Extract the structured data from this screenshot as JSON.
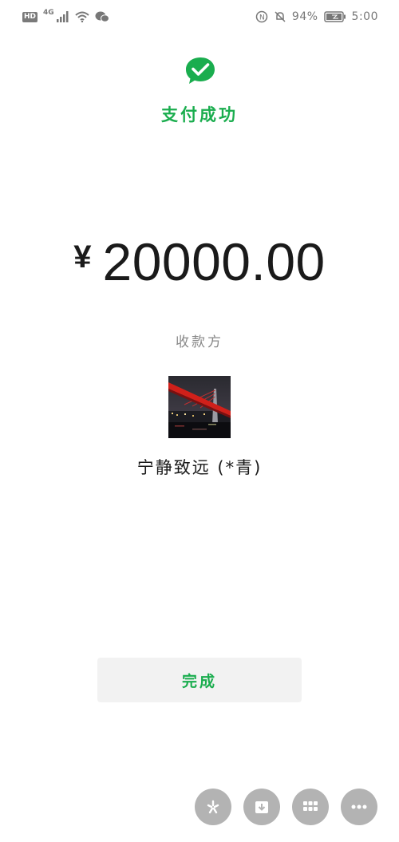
{
  "status_bar": {
    "hd_badge": "HD",
    "network_label": "4G",
    "battery_percent": "94%",
    "time": "5:00",
    "icons": [
      "signal-icon",
      "wifi-icon",
      "wechat-notification-icon",
      "nfc-icon",
      "mute-bell-icon",
      "battery-icon"
    ]
  },
  "header": {
    "logo_icon": "wechat-pay-check-icon",
    "title": "支付成功"
  },
  "payment": {
    "currency_symbol": "¥",
    "amount": "20000.00"
  },
  "payee": {
    "label": "收款方",
    "avatar_icon": "bridge-night-photo",
    "name": "宁静致远 (*青)"
  },
  "actions": {
    "done_label": "完成"
  },
  "floating_buttons": [
    {
      "icon": "sparkle-icon"
    },
    {
      "icon": "download-icon"
    },
    {
      "icon": "grid-icon"
    },
    {
      "icon": "more-icon"
    }
  ],
  "colors": {
    "accent_green": "#1aad4e",
    "button_bg": "#f2f2f2",
    "fab_bg": "#b3b3b3"
  }
}
